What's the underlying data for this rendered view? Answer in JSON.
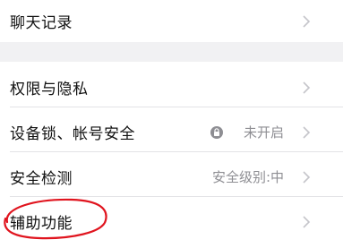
{
  "rows": {
    "chat_history": {
      "label": "聊天记录"
    },
    "privacy": {
      "label": "权限与隐私"
    },
    "device_lock": {
      "label": "设备锁、帐号安全",
      "status": "未开启"
    },
    "security_check": {
      "label": "安全检测",
      "status": "安全级别:中"
    },
    "accessibility": {
      "label": "辅助功能"
    }
  },
  "colors": {
    "background": "#f1f1f3",
    "row": "#ffffff",
    "secondary_text": "#8e8e93",
    "annotation": "#e0141e"
  }
}
